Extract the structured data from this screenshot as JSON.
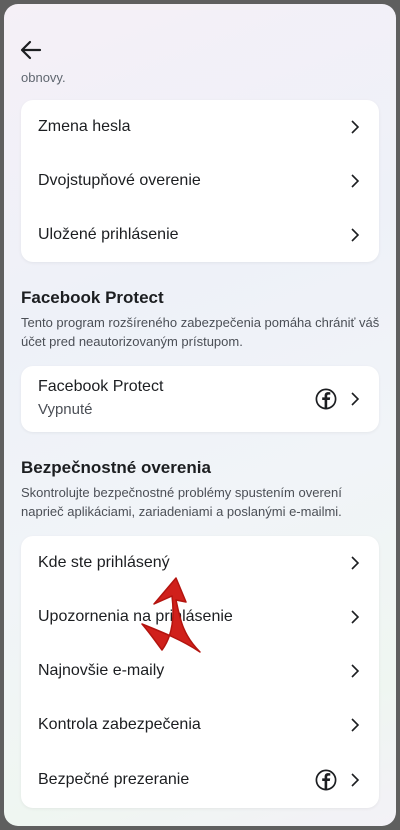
{
  "header": {
    "back_icon": "arrow-left-icon",
    "cut_text": "obnovy."
  },
  "login_card": {
    "items": [
      {
        "label": "Zmena hesla",
        "icon": "chevron-right-icon"
      },
      {
        "label": "Dvojstupňové overenie",
        "icon": "chevron-right-icon"
      },
      {
        "label": "Uložené prihlásenie",
        "icon": "chevron-right-icon"
      }
    ]
  },
  "facebook_protect": {
    "title": "Facebook Protect",
    "description": "Tento program rozšíreného zabezpečenia pomáha chrániť váš účet pred neautorizovaným prístupom.",
    "item": {
      "label": "Facebook Protect",
      "status": "Vypnuté",
      "icon": "facebook-icon"
    }
  },
  "security_checks": {
    "title": "Bezpečnostné overenia",
    "description": "Skontrolujte bezpečnostné problémy spustením overení naprieč aplikáciami, zariadeniami a poslanými e-mailmi.",
    "items": [
      {
        "label": "Kde ste prihlásený"
      },
      {
        "label": "Upozornenia na prihlásenie"
      },
      {
        "label": "Najnovšie e-maily"
      },
      {
        "label": "Kontrola zabezpečenia"
      },
      {
        "label": "Bezpečné prezeranie",
        "icon": "facebook-icon"
      }
    ]
  },
  "colors": {
    "accent_arrow": "#d0201b",
    "card_bg": "#ffffff",
    "text_primary": "#1c1e21",
    "text_secondary": "#4b4f56"
  }
}
